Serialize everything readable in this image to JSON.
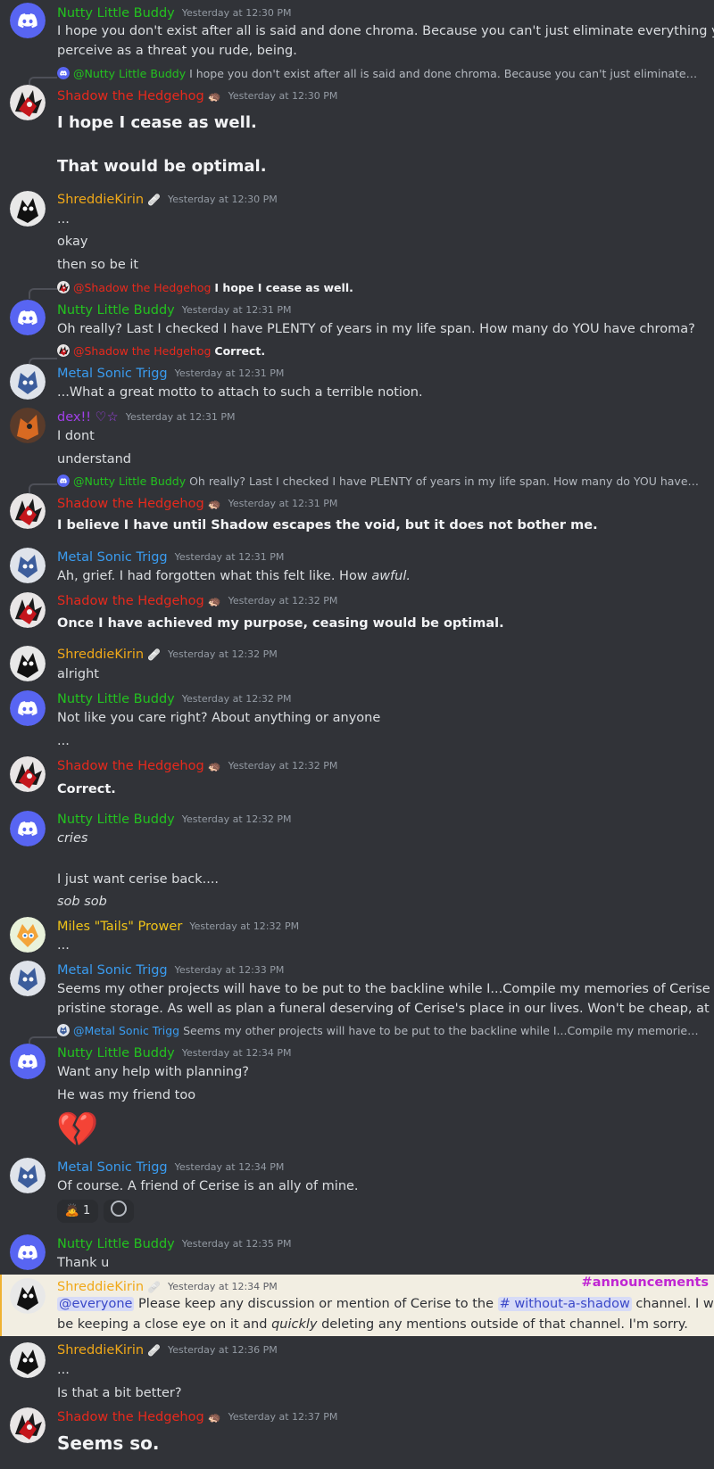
{
  "colors": {
    "background": "#313338",
    "nutty": "#23c21f",
    "shadow": "#e8291c",
    "shreddie": "#f0a818",
    "metal": "#3a9cf0",
    "dex": "#a140e8",
    "tails": "#f0c419",
    "highlight": "#f2eee2",
    "announcement_tag": "#c026d3"
  },
  "users": {
    "nutty": "Nutty Little Buddy",
    "shadow": "Shadow the Hedgehog",
    "shreddie": "ShreddieKirin",
    "metal": "Metal Sonic Trigg",
    "dex": "dex!! ♡☆",
    "tails": "Miles \"Tails\" Prower"
  },
  "messages": [
    {
      "ts": "Yesterday at 12:30 PM",
      "lines": [
        "I hope you don't exist after all is said and done chroma. Because you can't just eliminate everything you",
        "perceive as a threat you rude, being."
      ]
    },
    {
      "reply_to": "@Nutty Little Buddy",
      "reply_text": "I hope you don't exist after all is said and done chroma. Because you can't just eliminate everything you perceive as a threat you rude, being.",
      "ts": "Yesterday at 12:30 PM",
      "lines": [
        "I hope I cease as well.",
        "That would be optimal."
      ]
    },
    {
      "ts": "Yesterday at 12:30 PM",
      "lines": [
        "...",
        "okay",
        "then so be it"
      ]
    },
    {
      "reply_to": "@Shadow the Hedgehog",
      "reply_text": "I hope I cease as well.",
      "ts": "Yesterday at 12:31 PM",
      "lines": [
        "Oh really? Last I checked I have PLENTY of years in my life span. How many do YOU have chroma?"
      ]
    },
    {
      "reply_to": "@Shadow the Hedgehog",
      "reply_text": "Correct.",
      "ts": "Yesterday at 12:31 PM",
      "lines": [
        "...What a great motto to attach to such a terrible notion."
      ]
    },
    {
      "ts": "Yesterday at 12:31 PM",
      "lines": [
        "I dont",
        "understand"
      ]
    },
    {
      "reply_to": "@Nutty Little Buddy",
      "reply_text": "Oh really? Last I checked I have PLENTY of years in my life span. How many do YOU have chroma?",
      "ts": "Yesterday at 12:31 PM",
      "lines": [
        "I believe I have until Shadow escapes the void, but it does not bother me."
      ]
    },
    {
      "ts": "Yesterday at 12:31 PM",
      "line_a": "Ah, grief. I had forgotten what this felt like. How ",
      "line_b": "awful."
    },
    {
      "ts": "Yesterday at 12:32 PM",
      "lines": [
        "Once I have achieved my purpose, ceasing would be optimal."
      ]
    },
    {
      "ts": "Yesterday at 12:32 PM",
      "lines": [
        "alright"
      ]
    },
    {
      "ts": "Yesterday at 12:32 PM",
      "lines": [
        "Not like you care right? About anything or anyone",
        "..."
      ]
    },
    {
      "ts": "Yesterday at 12:32 PM",
      "lines": [
        "Correct."
      ]
    },
    {
      "ts": "Yesterday at 12:32 PM",
      "lines": [
        "cries",
        "I just want cerise back....",
        "sob sob"
      ]
    },
    {
      "ts": "Yesterday at 12:32 PM",
      "lines": [
        "..."
      ]
    },
    {
      "ts": "Yesterday at 12:33 PM",
      "lines": [
        "Seems my other projects will have to be put to the backline while I...Compile my memories of Cerise for",
        "pristine storage. As well as plan a funeral deserving of Cerise's place in our lives. Won't be cheap, at all."
      ]
    },
    {
      "reply_to": "@Metal Sonic Trigg",
      "reply_text": "Seems my other projects will have to be put to the backline while I...Compile my memories of Cerise for pristine storage.",
      "ts": "Yesterday at 12:34 PM",
      "lines": [
        "Want any help with planning?",
        "He was my friend too"
      ],
      "emoji": "💔"
    },
    {
      "ts": "Yesterday at 12:34 PM",
      "lines": [
        "Of course. A friend of Cerise is an ally of mine."
      ],
      "reaction_count": "1"
    },
    {
      "ts": "Yesterday at 12:35 PM",
      "lines": [
        "Thank u"
      ]
    },
    {
      "ts": "Yesterday at 12:34 PM",
      "tag": "#announcements",
      "mention": "@everyone",
      "text_a": " Please keep any discussion or mention of Cerise to the ",
      "channel": "# without-a-shadow",
      "text_b": " channel. I will",
      "text_c": "be keeping a close eye on it and ",
      "text_em": "quickly",
      "text_d": " deleting any mentions outside of that channel. I'm sorry."
    },
    {
      "ts": "Yesterday at 12:36 PM",
      "lines": [
        "...",
        "Is that a bit better?"
      ]
    },
    {
      "ts": "Yesterday at 12:37 PM",
      "lines": [
        "Seems so."
      ]
    }
  ]
}
